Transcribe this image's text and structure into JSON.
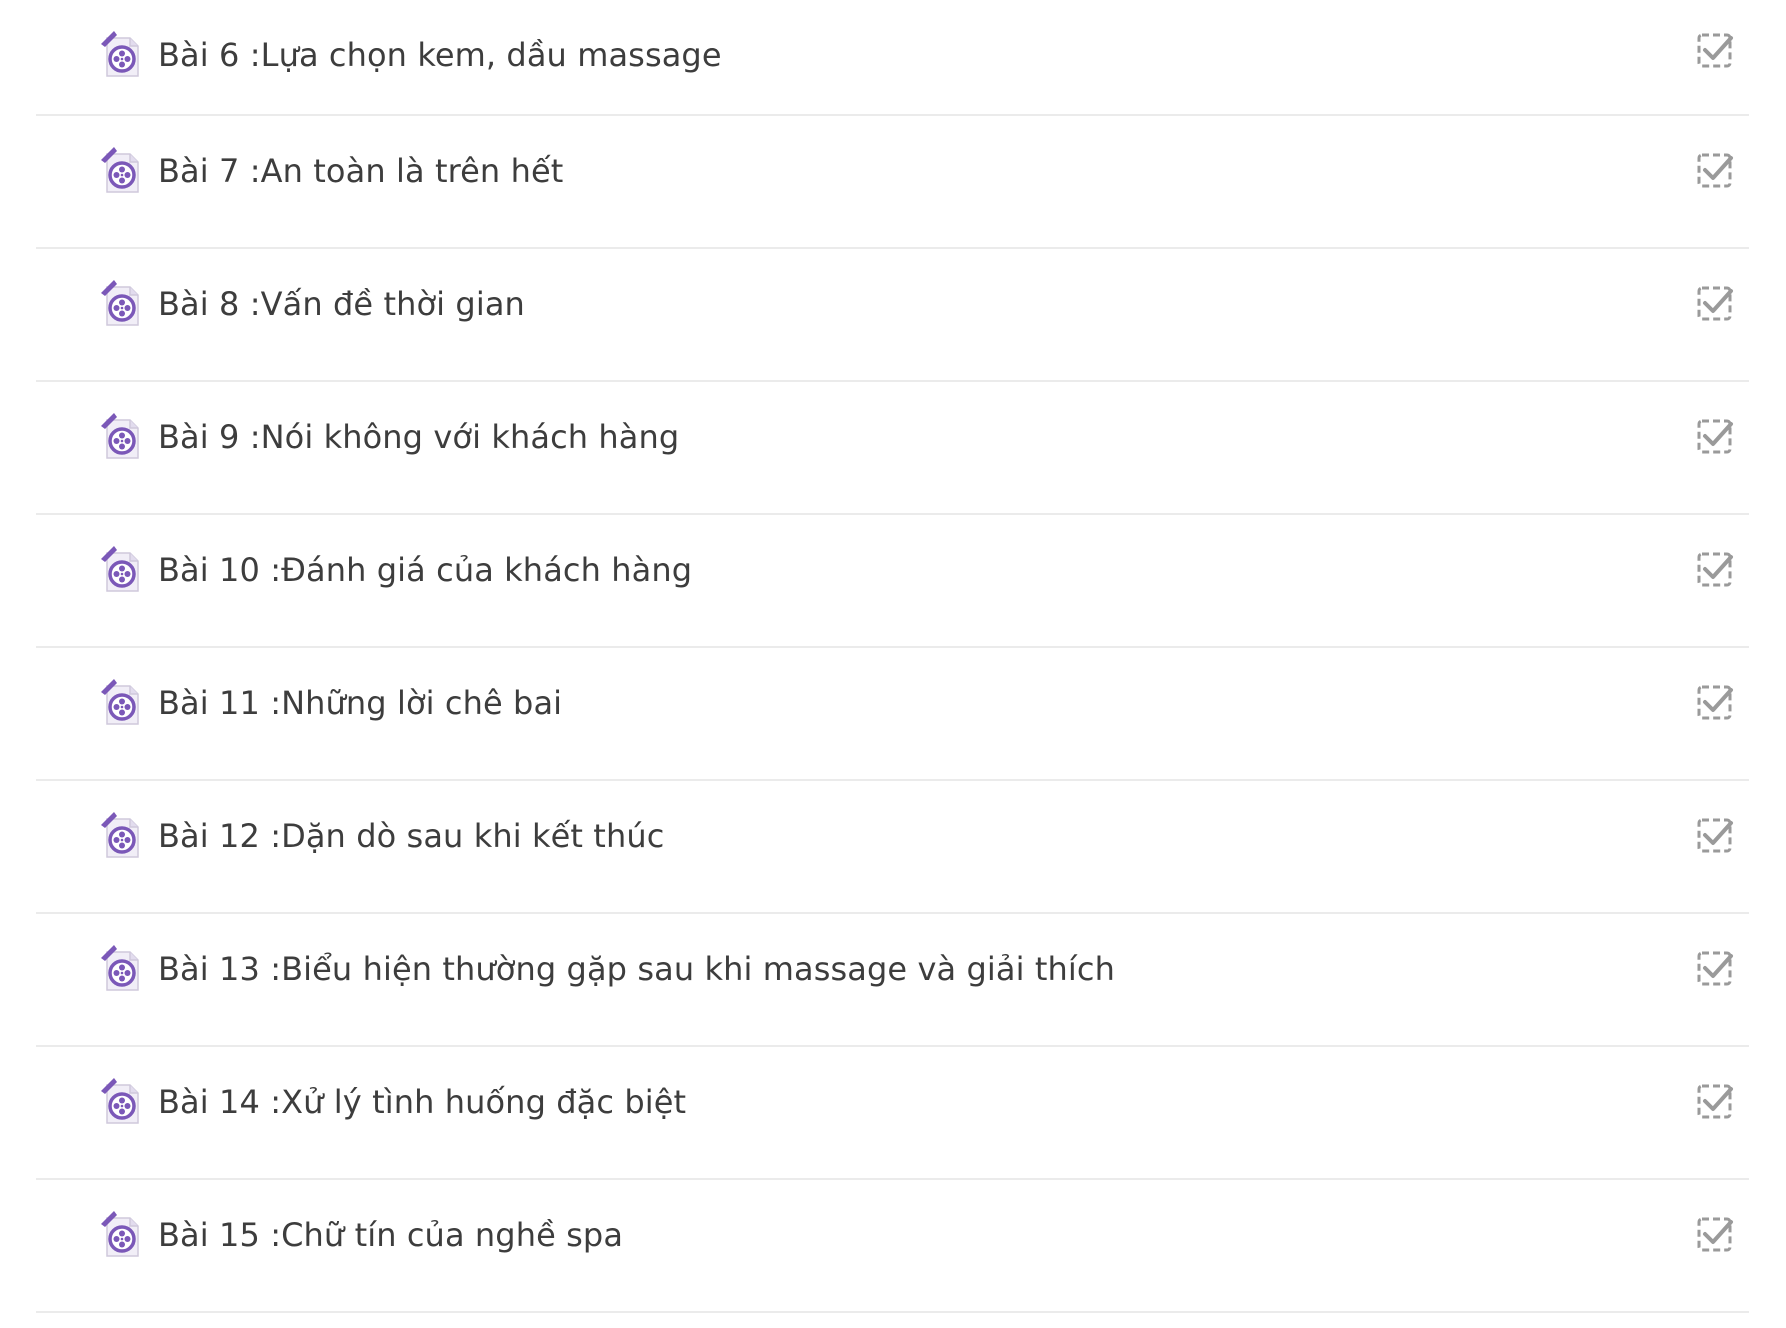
{
  "lessons": [
    {
      "title": "Bài 6 :Lựa chọn kem, dầu massage"
    },
    {
      "title": "Bài 7 :An toàn là trên hết"
    },
    {
      "title": "Bài 8 :Vấn đề thời gian"
    },
    {
      "title": "Bài 9 :Nói không với khách hàng"
    },
    {
      "title": "Bài 10 :Đánh giá của khách hàng"
    },
    {
      "title": "Bài 11 :Những lời chê bai"
    },
    {
      "title": "Bài 12 :Dặn dò sau khi kết thúc"
    },
    {
      "title": "Bài 13 :Biểu hiện thường gặp sau khi massage và giải thích"
    },
    {
      "title": "Bài 14 :Xử lý tình huống đặc biệt"
    },
    {
      "title": "Bài 15 :Chữ tín của nghề spa"
    }
  ],
  "icons": {
    "lesson_icon": "video-file-icon",
    "status_icon": "checkbox-checked-icon"
  },
  "colors": {
    "text": "#3d3d3d",
    "divider": "#ebebeb",
    "icon_accent": "#7b58b8",
    "check": "#9a9a9a"
  }
}
